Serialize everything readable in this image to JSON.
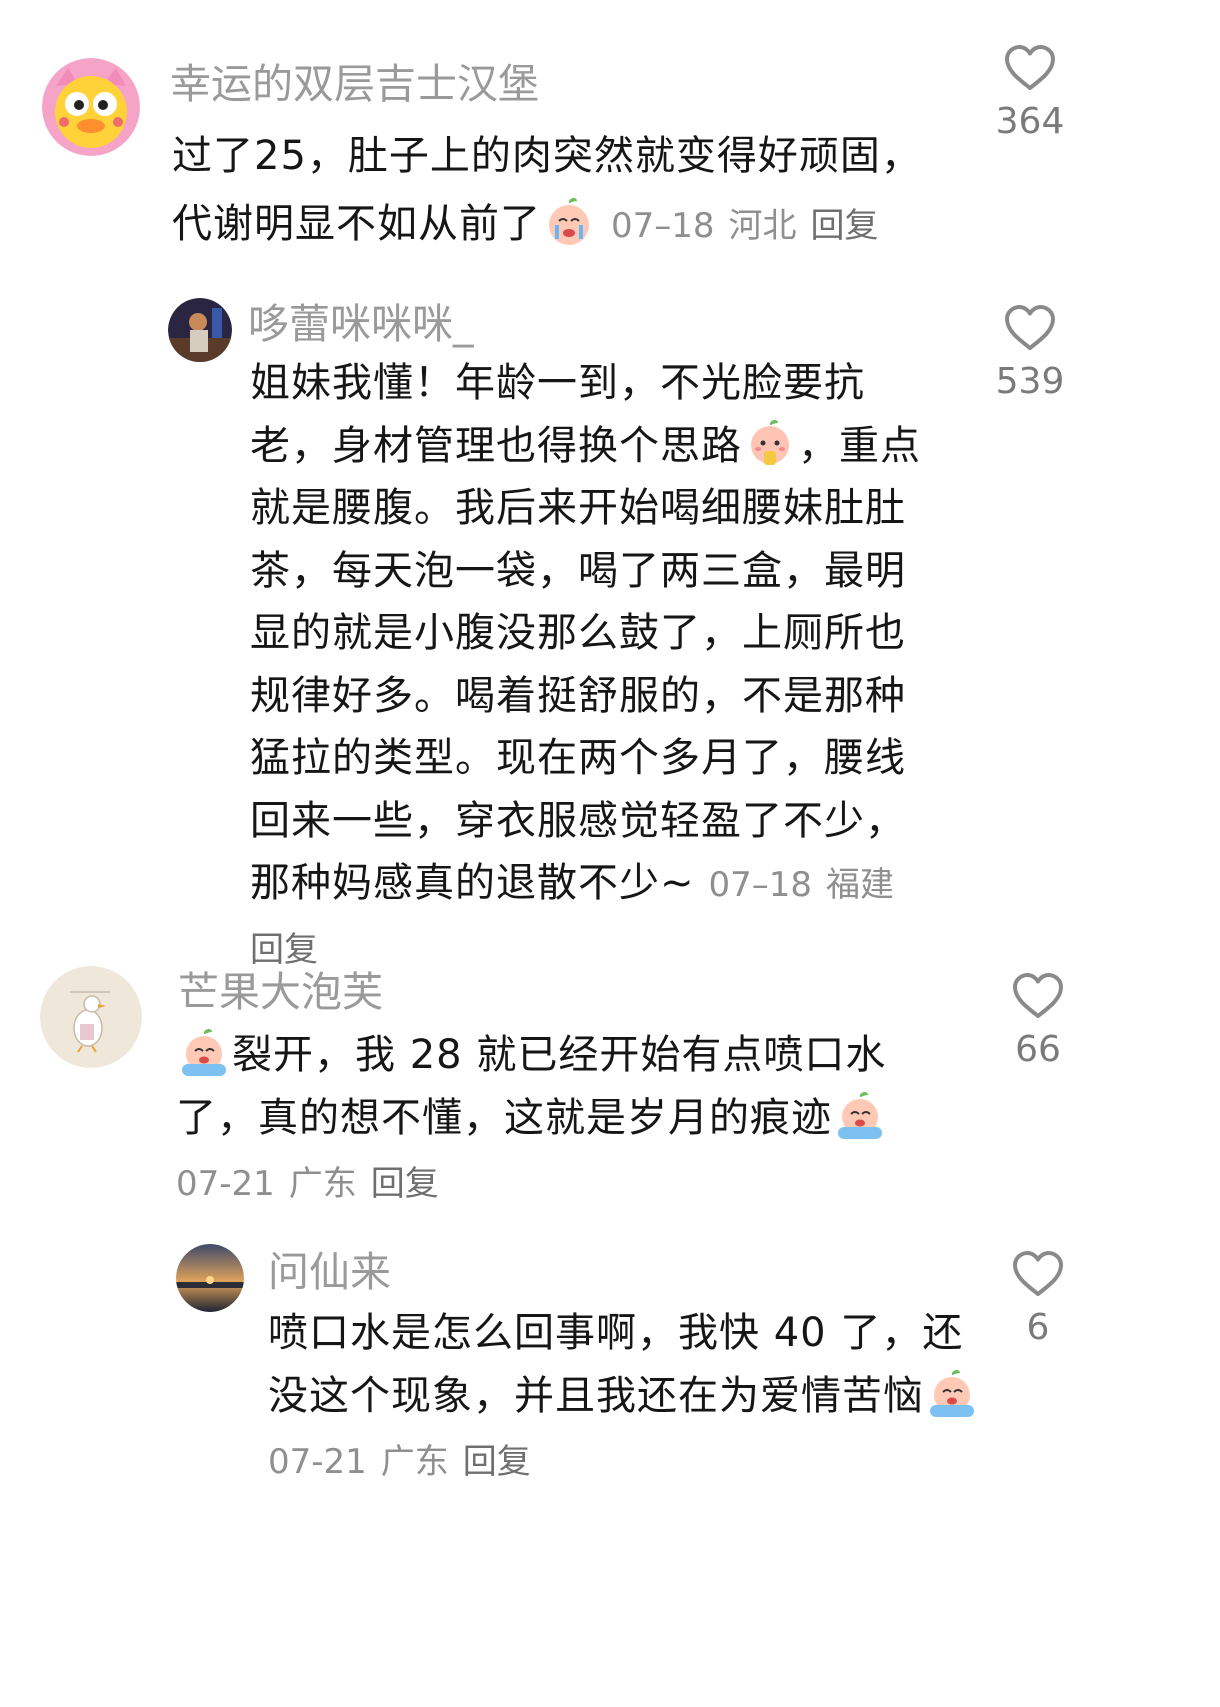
{
  "comments": [
    {
      "username": "幸运的双层吉士汉堡",
      "text": "过了25，肚子上的肉突然就变得好顽固，代谢明显不如从前了",
      "date": "07–18",
      "location": "河北",
      "reply_label": "回复",
      "likes": "364",
      "emoji": "crying-peach-emoji"
    },
    {
      "username": "哆蕾咪咪咪_",
      "text_part1": "姐妹我懂！年龄一到，不光脸要抗老，身材管理也得换个思路",
      "text_part2": "，重点就是腰腹。我后来开始喝细腰妹肚肚茶，每天泡一袋，喝了两三盒，最明显的就是小腹没那么鼓了，上厕所也规律好多。喝着挺舒服的，不是那种猛拉的类型。现在两个多月了，腰线回来一些，穿衣服感觉轻盈了不少，那种妈感真的退散不少~",
      "date": "07–18",
      "location": "福建",
      "reply_label": "回复",
      "likes": "539",
      "emoji": "peach-drinking-emoji"
    },
    {
      "username": "芒果大泡芙",
      "text_part1": "裂开，我 28 就已经开始有点喷口水了，真的想不懂，这就是岁月的痕迹",
      "date": "07-21",
      "location": "广东",
      "reply_label": "回复",
      "likes": "66",
      "emoji": "crying-peach-emoji"
    },
    {
      "username": "问仙来",
      "text_part1": "喷口水是怎么回事啊，我快 40 了，还没这个现象，并且我还在为爱情苦恼",
      "date": "07-21",
      "location": "广东",
      "reply_label": "回复",
      "likes": "6",
      "emoji": "crying-peach-emoji"
    }
  ],
  "colors": {
    "username": "#9a9a9a",
    "text": "#161616",
    "meta": "#8f8f8f",
    "heart": "#8a8a8a"
  }
}
